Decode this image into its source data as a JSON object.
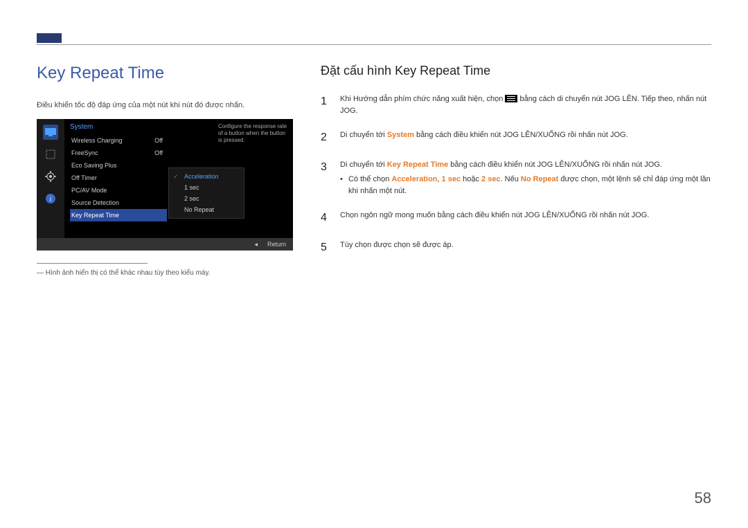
{
  "page_number": "58",
  "left": {
    "title": "Key Repeat Time",
    "description": "Điều khiển tốc độ đáp ứng của một nút khi nút đó được nhấn.",
    "footnote": "― Hình ảnh hiển thị có thể khác nhau tùy theo kiểu máy."
  },
  "osd": {
    "header": "System",
    "help": "Configure the response rate of a button when the button is pressed.",
    "items": [
      {
        "label": "Wireless Charging",
        "value": "Off"
      },
      {
        "label": "FreeSync",
        "value": "Off"
      },
      {
        "label": "Eco Saving Plus",
        "value": ""
      },
      {
        "label": "Off Timer",
        "value": ""
      },
      {
        "label": "PC/AV Mode",
        "value": ""
      },
      {
        "label": "Source Detection",
        "value": ""
      },
      {
        "label": "Key Repeat Time",
        "value": ""
      }
    ],
    "selected_index": 6,
    "submenu": [
      "Acceleration",
      "1 sec",
      "2 sec",
      "No Repeat"
    ],
    "submenu_selected": 0,
    "footer_left": "◂",
    "footer_right": "Return"
  },
  "right": {
    "heading": "Đặt cấu hình Key Repeat Time",
    "steps": {
      "s1_a": "Khi Hướng dẫn phím chức năng xuất hiện, chọn ",
      "s1_b": " bằng cách di chuyển nút JOG LÊN. Tiếp theo, nhấn nút JOG.",
      "s2_a": "Di chuyển tới ",
      "s2_kw": "System",
      "s2_b": " bằng cách điều khiển nút JOG LÊN/XUỐNG rồi nhấn nút JOG.",
      "s3_a": "Di chuyển tới ",
      "s3_kw": "Key Repeat Time",
      "s3_b": " bằng cách điều khiển nút JOG LÊN/XUỐNG rồi nhấn nút JOG.",
      "s3_sub_a": "Có thể chọn ",
      "s3_sub_kw1": "Acceleration",
      "s3_sub_sep1": ", ",
      "s3_sub_kw2": "1 sec",
      "s3_sub_sep2": " hoặc ",
      "s3_sub_kw3": "2 sec",
      "s3_sub_sep3": ". Nếu ",
      "s3_sub_kw4": "No Repeat",
      "s3_sub_b": " được chọn, một lệnh sẽ chỉ đáp ứng một lần khi nhấn một nút.",
      "s4": "Chọn ngôn ngữ mong muốn bằng cách điều khiển nút JOG LÊN/XUỐNG rồi nhấn nút JOG.",
      "s5": "Tùy chọn được chọn sẽ được áp."
    },
    "nums": [
      "1",
      "2",
      "3",
      "4",
      "5"
    ]
  }
}
